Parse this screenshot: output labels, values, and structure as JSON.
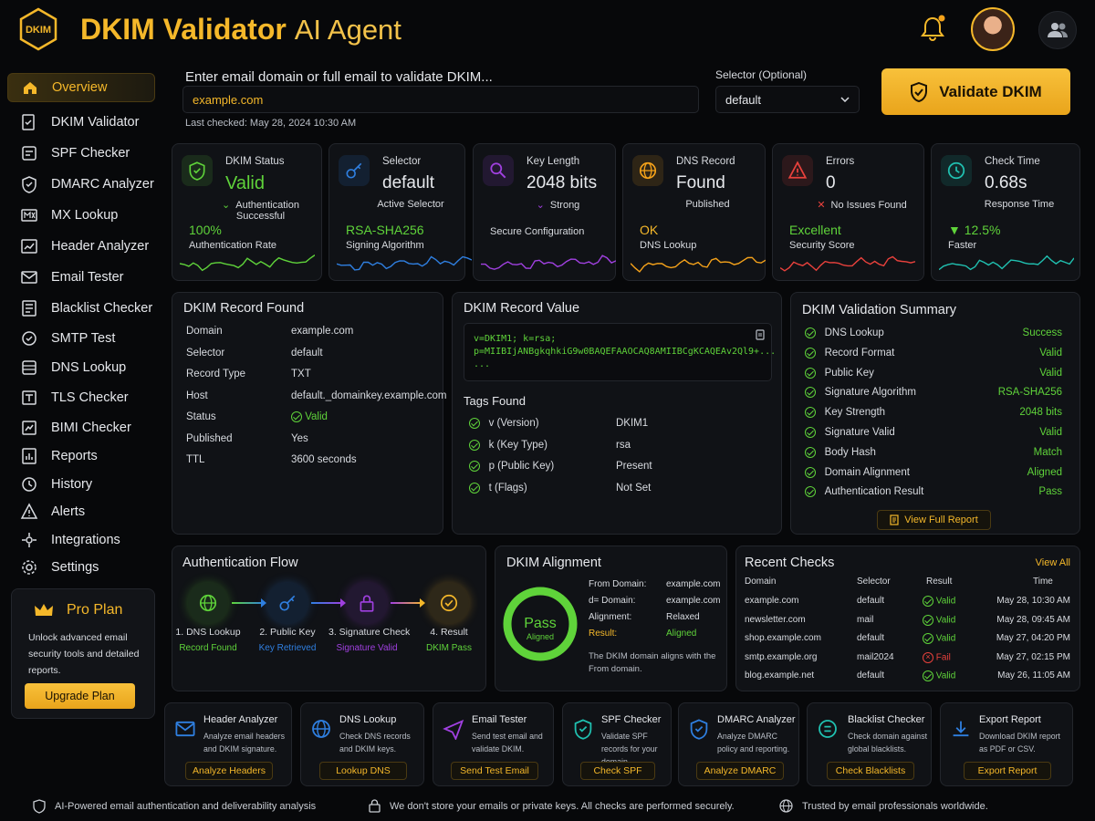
{
  "header": {
    "logo_text": "DKIM",
    "title": "DKIM Validator",
    "title_suffix": "AI Agent"
  },
  "sidebar": {
    "items": [
      {
        "label": "Overview",
        "icon": "home-icon"
      },
      {
        "label": "DKIM Validator",
        "icon": "doc-check-icon"
      },
      {
        "label": "SPF Checker",
        "icon": "spf-icon"
      },
      {
        "label": "DMARC Analyzer",
        "icon": "shield-check-icon"
      },
      {
        "label": "MX Lookup",
        "icon": "mx-icon"
      },
      {
        "label": "Header Analyzer",
        "icon": "header-icon"
      },
      {
        "label": "Email Tester",
        "icon": "mail-icon"
      },
      {
        "label": "Blacklist Checker",
        "icon": "list-icon"
      },
      {
        "label": "SMTP Test",
        "icon": "smtp-icon"
      },
      {
        "label": "DNS Lookup",
        "icon": "dns-icon"
      },
      {
        "label": "TLS Checker",
        "icon": "tls-icon"
      },
      {
        "label": "BIMI Checker",
        "icon": "bimi-icon"
      },
      {
        "label": "Reports",
        "icon": "reports-icon"
      },
      {
        "label": "History",
        "icon": "history-icon"
      },
      {
        "label": "Alerts",
        "icon": "alert-icon"
      },
      {
        "label": "Integrations",
        "icon": "integrations-icon"
      },
      {
        "label": "Settings",
        "icon": "settings-icon"
      }
    ],
    "pro": {
      "title": "Pro Plan",
      "desc": "Unlock advanced email security tools and detailed reports.",
      "button": "Upgrade Plan"
    }
  },
  "search": {
    "label": "Enter email domain or full email to validate DKIM...",
    "value": "example.com",
    "last_checked": "Last checked: May 28, 2024 10:30 AM",
    "selector_label": "Selector (Optional)",
    "selector_value": "default",
    "button": "Validate DKIM"
  },
  "cards": [
    {
      "label": "DKIM Status",
      "value": "Valid",
      "sub": "Authentication Successful",
      "big": "100%",
      "small": "Authentication Rate",
      "color": "#5fd33a"
    },
    {
      "label": "Selector",
      "value": "default",
      "sub": "Active Selector",
      "big": "RSA-SHA256",
      "small": "Signing Algorithm",
      "color": "#2f7fe0"
    },
    {
      "label": "Key Length",
      "value": "2048 bits",
      "sub": "Strong",
      "big": "",
      "small": "Secure Configuration",
      "color": "#a040e0"
    },
    {
      "label": "DNS Record",
      "value": "Found",
      "sub": "Published",
      "big": "OK",
      "small": "DNS Lookup",
      "color": "#f5a21a"
    },
    {
      "label": "Errors",
      "value": "0",
      "sub": "No Issues Found",
      "big": "Excellent",
      "small": "Security Score",
      "color": "#e8413c"
    },
    {
      "label": "Check Time",
      "value": "0.68s",
      "sub": "Response Time",
      "big": "▼ 12.5%",
      "small": "Faster",
      "color": "#20c0b0"
    }
  ],
  "record": {
    "title": "DKIM Record Found",
    "rows": [
      {
        "k": "Domain",
        "v": "example.com"
      },
      {
        "k": "Selector",
        "v": "default"
      },
      {
        "k": "Record Type",
        "v": "TXT"
      },
      {
        "k": "Host",
        "v": "default._domainkey.example.com"
      },
      {
        "k": "Status",
        "v": "Valid"
      },
      {
        "k": "Published",
        "v": "Yes"
      },
      {
        "k": "TTL",
        "v": "3600 seconds"
      }
    ]
  },
  "record_value": {
    "title": "DKIM Record Value",
    "lines": [
      "v=DKIM1; k=rsa;",
      "p=MIIBIjANBgkqhkiG9w0BAQEFAAOCAQ8AMIIBCgKCAQEAv2Ql9+...",
      "..."
    ],
    "tags_title": "Tags Found",
    "tags": [
      {
        "k": "v (Version)",
        "v": "DKIM1"
      },
      {
        "k": "k (Key Type)",
        "v": "rsa"
      },
      {
        "k": "p (Public Key)",
        "v": "Present"
      },
      {
        "k": "t (Flags)",
        "v": "Not Set"
      }
    ]
  },
  "summary": {
    "title": "DKIM Validation Summary",
    "rows": [
      {
        "k": "DNS Lookup",
        "v": "Success"
      },
      {
        "k": "Record Format",
        "v": "Valid"
      },
      {
        "k": "Public Key",
        "v": "Valid"
      },
      {
        "k": "Signature Algorithm",
        "v": "RSA-SHA256"
      },
      {
        "k": "Key Strength",
        "v": "2048 bits"
      },
      {
        "k": "Signature Valid",
        "v": "Valid"
      },
      {
        "k": "Body Hash",
        "v": "Match"
      },
      {
        "k": "Domain Alignment",
        "v": "Aligned"
      },
      {
        "k": "Authentication Result",
        "v": "Pass"
      }
    ],
    "button": "View Full Report"
  },
  "flow": {
    "title": "Authentication Flow",
    "steps": [
      {
        "label": "1. DNS Lookup",
        "status": "Record Found",
        "color": "#5fd33a"
      },
      {
        "label": "2. Public Key",
        "status": "Key Retrieved",
        "color": "#2f7fe0"
      },
      {
        "label": "3. Signature Check",
        "status": "Signature Valid",
        "color": "#a040e0"
      },
      {
        "label": "4. Result",
        "status": "DKIM Pass",
        "color": "#f5b82a"
      }
    ]
  },
  "alignment": {
    "title": "DKIM Alignment",
    "ring_main": "Pass",
    "ring_sub": "Aligned",
    "ring_fill": 1.0,
    "rows": [
      {
        "k": "From Domain:",
        "v": "example.com"
      },
      {
        "k": "d= Domain:",
        "v": "example.com"
      },
      {
        "k": "Alignment:",
        "v": "Relaxed"
      },
      {
        "k": "Result:",
        "v": "Aligned"
      }
    ],
    "note": "The DKIM domain aligns with the From domain."
  },
  "recent": {
    "title": "Recent Checks",
    "view_all": "View All",
    "headers": [
      "Domain",
      "Selector",
      "Result",
      "Time"
    ],
    "rows": [
      {
        "domain": "example.com",
        "selector": "default",
        "result": "Valid",
        "time": "May 28, 10:30 AM",
        "ok": true
      },
      {
        "domain": "newsletter.com",
        "selector": "mail",
        "result": "Valid",
        "time": "May 28, 09:45 AM",
        "ok": true
      },
      {
        "domain": "shop.example.com",
        "selector": "default",
        "result": "Valid",
        "time": "May 27, 04:20 PM",
        "ok": true
      },
      {
        "domain": "smtp.example.org",
        "selector": "mail2024",
        "result": "Fail",
        "time": "May 27, 02:15 PM",
        "ok": false
      },
      {
        "domain": "blog.example.net",
        "selector": "default",
        "result": "Valid",
        "time": "May 26, 11:05 AM",
        "ok": true
      }
    ]
  },
  "tools": [
    {
      "title": "Header Analyzer",
      "desc": "Analyze email headers and DKIM signature.",
      "button": "Analyze Headers",
      "icon": "mail-icon",
      "color": "#2f7fe0"
    },
    {
      "title": "DNS Lookup",
      "desc": "Check DNS records and DKIM keys.",
      "button": "Lookup DNS",
      "icon": "globe-icon",
      "color": "#2f7fe0"
    },
    {
      "title": "Email Tester",
      "desc": "Send test email and validate DKIM.",
      "button": "Send Test Email",
      "icon": "send-icon",
      "color": "#a040e0"
    },
    {
      "title": "SPF Checker",
      "desc": "Validate SPF records for your domain.",
      "button": "Check SPF",
      "icon": "shield-icon",
      "color": "#20c0b0"
    },
    {
      "title": "DMARC Analyzer",
      "desc": "Analyze DMARC policy and reporting.",
      "button": "Analyze DMARC",
      "icon": "shield-check-icon",
      "color": "#2f7fe0"
    },
    {
      "title": "Blacklist Checker",
      "desc": "Check domain against global blacklists.",
      "button": "Check Blacklists",
      "icon": "blacklist-icon",
      "color": "#20c0b0"
    },
    {
      "title": "Export Report",
      "desc": "Download DKIM report as PDF or CSV.",
      "button": "Export Report",
      "icon": "download-icon",
      "color": "#2f7fe0"
    }
  ],
  "footer": {
    "left": "AI-Powered email authentication and deliverability analysis",
    "center": "We don't store your emails or private keys. All checks are performed securely.",
    "right": "Trusted by email professionals worldwide."
  }
}
